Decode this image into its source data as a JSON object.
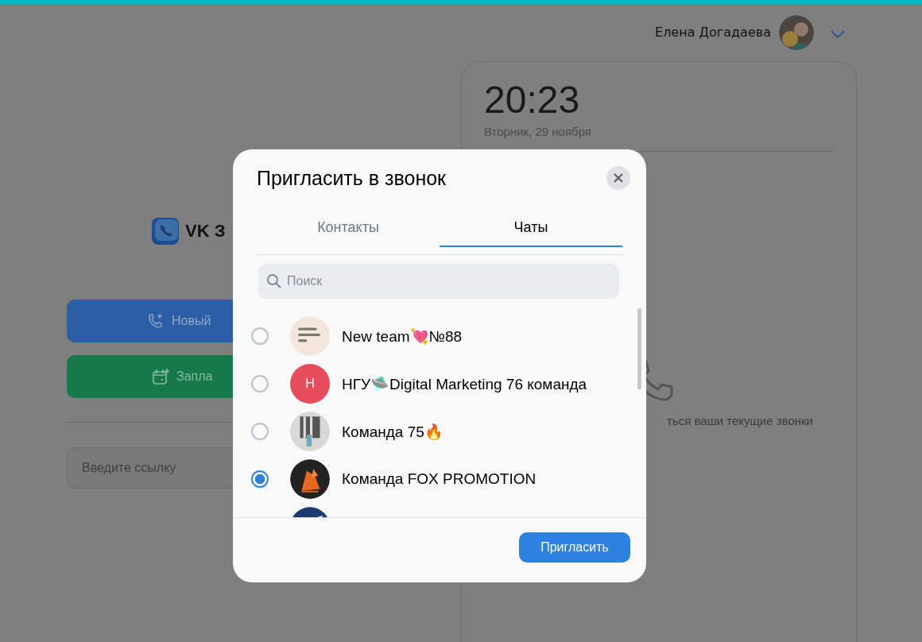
{
  "header": {
    "user_name": "Елена Догадаева"
  },
  "left": {
    "logo_text": "VK З",
    "buttons": [
      {
        "kind": "new-call",
        "label": "Новый"
      },
      {
        "kind": "schedule",
        "label": "Запла"
      }
    ],
    "link_field": {
      "placeholder": "Введите ссылку"
    }
  },
  "clock": {
    "time": "20:23",
    "date": "Вторник, 29 ноября",
    "empty_text": "ться ваши текущие звонки"
  },
  "modal": {
    "title": "Пригласить в звонок",
    "tabs": [
      {
        "label": "Контакты",
        "selected": false
      },
      {
        "label": "Чаты",
        "selected": true
      }
    ],
    "search": {
      "placeholder": "Поиск"
    },
    "chats": [
      {
        "name": "New team💘№88",
        "avatar": {
          "kind": "picture"
        },
        "selected": false
      },
      {
        "name": "НГУ🛸Digital Marketing 76 команда",
        "avatar": {
          "kind": "letter",
          "letter": "Н"
        },
        "selected": false
      },
      {
        "name": "Команда 75🔥",
        "avatar": {
          "kind": "picture"
        },
        "selected": false
      },
      {
        "name": "Команда FOX PROMOTION",
        "avatar": {
          "kind": "picture"
        },
        "selected": true
      },
      {
        "avatar": {
          "kind": "picture"
        }
      }
    ],
    "invite_button": "Пригласить"
  }
}
